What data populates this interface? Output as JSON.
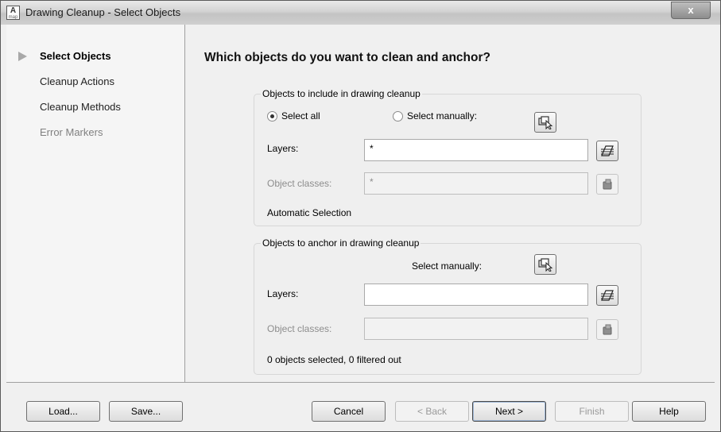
{
  "window": {
    "title": "Drawing Cleanup - Select Objects",
    "app_icon_letter": "A",
    "app_icon_sub": "map",
    "close_glyph": "x"
  },
  "nav": {
    "items": [
      {
        "label": "Select Objects",
        "state": "active"
      },
      {
        "label": "Cleanup Actions",
        "state": "normal"
      },
      {
        "label": "Cleanup Methods",
        "state": "normal"
      },
      {
        "label": "Error Markers",
        "state": "disabled"
      }
    ]
  },
  "main": {
    "heading": "Which objects do you want to clean and anchor?",
    "include_group": {
      "title": "Objects to include in drawing cleanup",
      "radio_select_all": "Select all",
      "radio_select_manually": "Select manually:",
      "selected_option": "select_all",
      "layers_label": "Layers:",
      "layers_value": "*",
      "object_classes_label": "Object classes:",
      "object_classes_value": "*",
      "status": "Automatic Selection"
    },
    "anchor_group": {
      "title": "Objects to anchor in drawing cleanup",
      "select_manually_label": "Select manually:",
      "layers_label": "Layers:",
      "layers_value": "",
      "object_classes_label": "Object classes:",
      "object_classes_value": "",
      "status": "0 objects selected, 0 filtered out"
    }
  },
  "footer": {
    "load": "Load...",
    "save": "Save...",
    "cancel": "Cancel",
    "back": "< Back",
    "next": "Next >",
    "finish": "Finish",
    "help": "Help"
  },
  "icons": {
    "select_objects": "select-objects-icon",
    "layer_list": "layer-list-icon",
    "object_class": "object-class-icon"
  }
}
